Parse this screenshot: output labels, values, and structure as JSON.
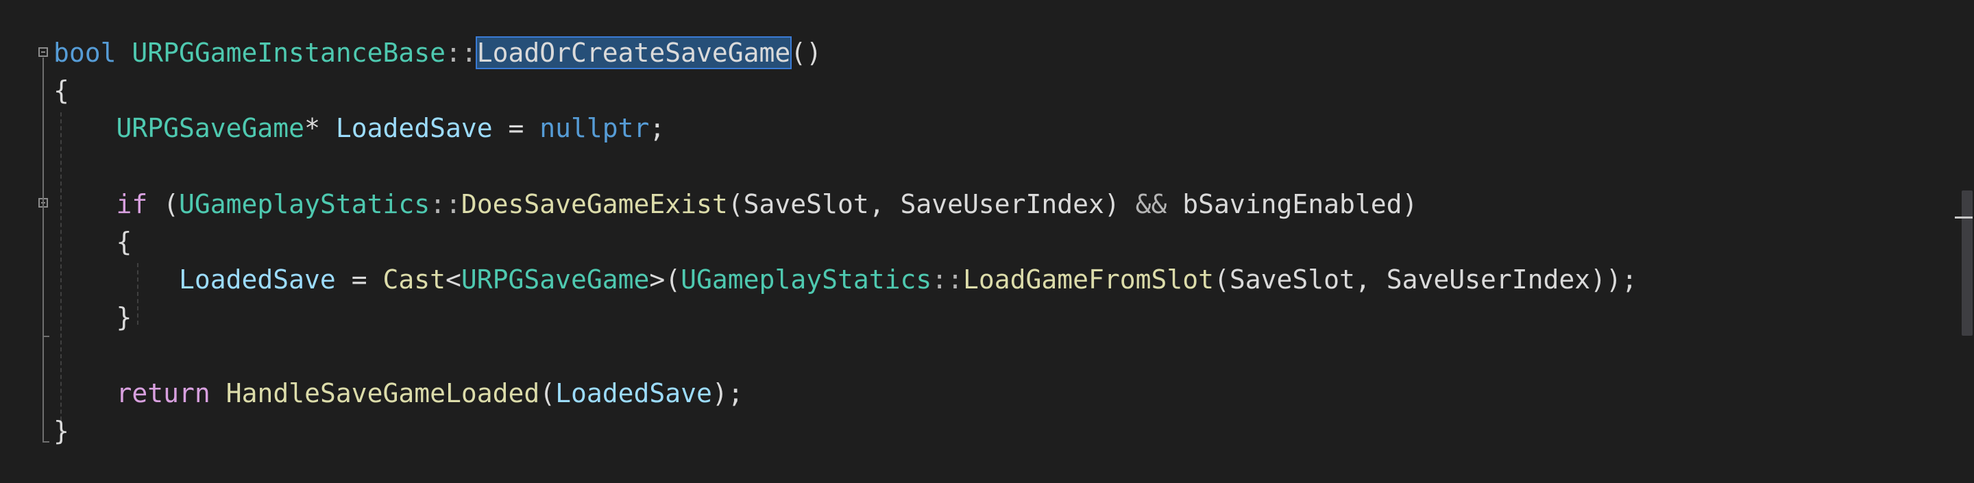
{
  "editor": {
    "lines": [
      {
        "tokens": [
          {
            "text": "bool",
            "cls": "kw"
          },
          {
            "text": " ",
            "cls": "txt"
          },
          {
            "text": "URPGGameInstanceBase",
            "cls": "type"
          },
          {
            "text": "::",
            "cls": "punc"
          },
          {
            "text": "LoadOrCreateSaveGame",
            "cls": "sel"
          },
          {
            "text": "()",
            "cls": "txt"
          }
        ]
      },
      {
        "tokens": [
          {
            "text": "{",
            "cls": "txt"
          }
        ]
      },
      {
        "tokens": [
          {
            "text": "    ",
            "cls": "txt"
          },
          {
            "text": "URPGSaveGame",
            "cls": "type"
          },
          {
            "text": "* ",
            "cls": "txt"
          },
          {
            "text": "LoadedSave",
            "cls": "var"
          },
          {
            "text": " = ",
            "cls": "txt"
          },
          {
            "text": "nullptr",
            "cls": "kw"
          },
          {
            "text": ";",
            "cls": "txt"
          }
        ]
      },
      {
        "tokens": [
          {
            "text": "",
            "cls": "txt"
          }
        ]
      },
      {
        "tokens": [
          {
            "text": "    ",
            "cls": "txt"
          },
          {
            "text": "if",
            "cls": "kw2"
          },
          {
            "text": " (",
            "cls": "txt"
          },
          {
            "text": "UGameplayStatics",
            "cls": "type"
          },
          {
            "text": "::",
            "cls": "punc"
          },
          {
            "text": "DoesSaveGameExist",
            "cls": "fn"
          },
          {
            "text": "(SaveSlot, SaveUserIndex) ",
            "cls": "txt"
          },
          {
            "text": "&&",
            "cls": "punc"
          },
          {
            "text": " bSavingEnabled)",
            "cls": "txt"
          }
        ]
      },
      {
        "tokens": [
          {
            "text": "    {",
            "cls": "txt"
          }
        ]
      },
      {
        "tokens": [
          {
            "text": "        ",
            "cls": "txt"
          },
          {
            "text": "LoadedSave",
            "cls": "var"
          },
          {
            "text": " = ",
            "cls": "txt"
          },
          {
            "text": "Cast",
            "cls": "fn"
          },
          {
            "text": "<",
            "cls": "txt"
          },
          {
            "text": "URPGSaveGame",
            "cls": "type"
          },
          {
            "text": ">(",
            "cls": "txt"
          },
          {
            "text": "UGameplayStatics",
            "cls": "type"
          },
          {
            "text": "::",
            "cls": "punc"
          },
          {
            "text": "LoadGameFromSlot",
            "cls": "fn"
          },
          {
            "text": "(SaveSlot, SaveUserIndex));",
            "cls": "txt"
          }
        ]
      },
      {
        "tokens": [
          {
            "text": "    }",
            "cls": "txt"
          }
        ]
      },
      {
        "tokens": [
          {
            "text": "",
            "cls": "txt"
          }
        ]
      },
      {
        "tokens": [
          {
            "text": "    ",
            "cls": "txt"
          },
          {
            "text": "return",
            "cls": "kw2"
          },
          {
            "text": " ",
            "cls": "txt"
          },
          {
            "text": "HandleSaveGameLoaded",
            "cls": "fn"
          },
          {
            "text": "(",
            "cls": "txt"
          },
          {
            "text": "LoadedSave",
            "cls": "var"
          },
          {
            "text": ");",
            "cls": "txt"
          }
        ]
      },
      {
        "tokens": [
          {
            "text": "}",
            "cls": "txt"
          }
        ]
      }
    ]
  },
  "gutter": {
    "fold_icons": [
      "collapse-icon",
      "collapse-icon"
    ]
  },
  "colors": {
    "background": "#1e1e1e",
    "selection": "#264f78",
    "keyword": "#569cd6",
    "control_keyword": "#d8a0df",
    "type": "#4ec9b0",
    "function": "#dcdcaa",
    "variable": "#9cdcfe"
  }
}
